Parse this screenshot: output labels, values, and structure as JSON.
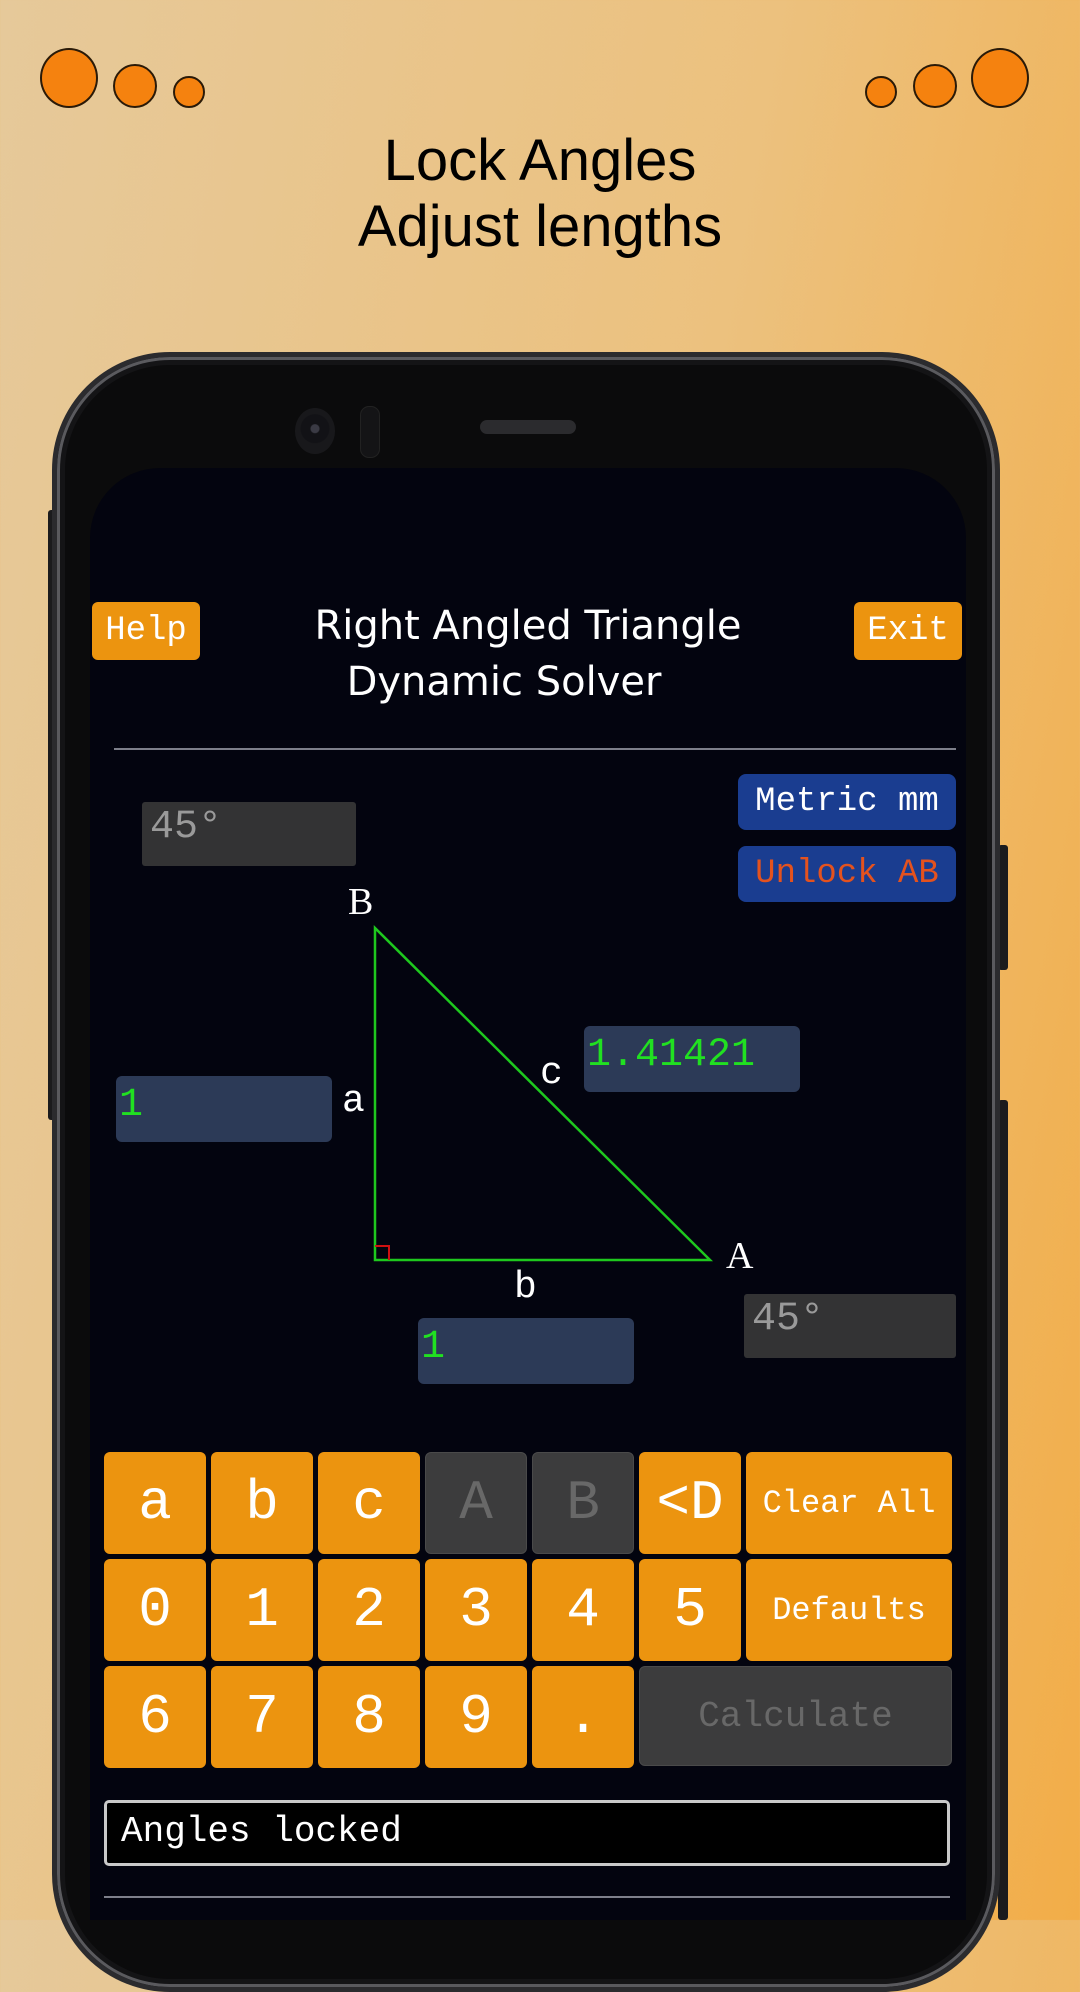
{
  "promo": {
    "line1": "Lock Angles",
    "line2": "Adjust lengths",
    "accent_color": "#f5820f"
  },
  "app": {
    "title_line1": "Right Angled Triangle",
    "title_line2": "Dynamic  Solver",
    "help_label": "Help",
    "exit_label": "Exit",
    "units_label": "Metric mm",
    "unlock_label": "Unlock AB",
    "unlock_color": "#e4521e",
    "fields": {
      "angle_B": "45°",
      "angle_A": "45°",
      "side_a": "1",
      "side_b": "1",
      "side_c": "1.41421"
    },
    "vertex_labels": {
      "A": "A",
      "B": "B"
    },
    "side_labels": {
      "a": "a",
      "b": "b",
      "c": "c"
    },
    "triangle_color": "#1ec81e",
    "right_angle_marker_color": "#d01010",
    "keypad": {
      "row1": [
        {
          "label": "a",
          "enabled": true
        },
        {
          "label": "b",
          "enabled": true
        },
        {
          "label": "c",
          "enabled": true
        },
        {
          "label": "A",
          "enabled": false
        },
        {
          "label": "B",
          "enabled": false
        },
        {
          "label": "<D",
          "enabled": true
        },
        {
          "label": "Clear All",
          "enabled": true
        }
      ],
      "row2": [
        {
          "label": "0",
          "enabled": true
        },
        {
          "label": "1",
          "enabled": true
        },
        {
          "label": "2",
          "enabled": true
        },
        {
          "label": "3",
          "enabled": true
        },
        {
          "label": "4",
          "enabled": true
        },
        {
          "label": "5",
          "enabled": true
        },
        {
          "label": "Defaults",
          "enabled": true
        }
      ],
      "row3": [
        {
          "label": "6",
          "enabled": true
        },
        {
          "label": "7",
          "enabled": true
        },
        {
          "label": "8",
          "enabled": true
        },
        {
          "label": "9",
          "enabled": true
        },
        {
          "label": ".",
          "enabled": true
        },
        {
          "label": "Calculate",
          "enabled": false
        }
      ]
    },
    "status_message": "Angles locked"
  }
}
